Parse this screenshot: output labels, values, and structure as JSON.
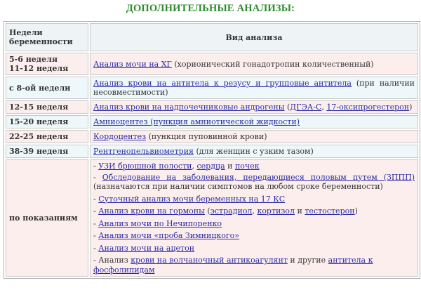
{
  "title": "ДОПОЛНИТЕЛЬНЫЕ АНАЛИЗЫ:",
  "header": {
    "weeks": "Недели беременности",
    "type": "Вид анализа"
  },
  "rows": [
    {
      "weeks": [
        "5-6 неделя",
        "11-12 неделя"
      ],
      "link": "Анализ мочи на ХГ",
      "rest": " (хорионический гонадотропин количественный)"
    },
    {
      "weeks": [
        "с 8-ой недели"
      ],
      "link": "Анализ крови на антитела к резусу и групповые антитела",
      "rest": " (при наличии несовместимости)"
    },
    {
      "weeks": [
        "12-15 неделя"
      ],
      "link": "Анализ крови на надпочечниковые андрогены",
      "t1": " (",
      "link2": "ДГЭА-С",
      "t2": ", ",
      "link3": "17-оксипрогестерон",
      "t3": ")"
    },
    {
      "weeks": [
        "15-20 неделя"
      ],
      "link": "Амниоцентез (пункция амниотической жидкости)"
    },
    {
      "weeks": [
        "22-25 неделя"
      ],
      "link": "Кордоцентез",
      "rest": " (пункция пуповинной крови)"
    },
    {
      "weeks": [
        "38-39 неделя"
      ],
      "link": "Рентгенопельвиометрия",
      "rest": " (для женщин с узким тазом)"
    }
  ],
  "indications": {
    "weeks": "по показаниям",
    "i1": {
      "dash": "- ",
      "l1": "УЗИ брюшной полости",
      "s1": ", ",
      "l2": "сердца",
      "s2": " и ",
      "l3": "почек"
    },
    "i2": {
      "dash": "- ",
      "l1": "Обследование на заболевания, передающиеся половым путем (ЗППП)",
      "rest": " (назначаются при наличии симптомов на любом сроке беременности)"
    },
    "i3": {
      "dash": "- ",
      "l1": "Суточный анализ мочи беременных на 17 КС"
    },
    "i4": {
      "dash": "- ",
      "l1": "Анализ крови на гормоны",
      "s1": " (",
      "l2": "эстрадиол",
      "s2": ", ",
      "l3": "кортизол",
      "s3": " и ",
      "l4": "тестостерон",
      "s4": ")"
    },
    "i5": {
      "dash": "- ",
      "l1": "Анализ мочи по Нечипоренко"
    },
    "i6": {
      "dash": "- ",
      "l1": "Анализ мочи «проба Зимницкого»"
    },
    "i7": {
      "dash": "- ",
      "l1": "Анализ мочи на ацетон"
    },
    "i8": {
      "dash": "- Анализ ",
      "l1": "крови на волчаночный антикоагулянт",
      "s1": " и другие ",
      "l2": "антитела к фосфолипидам"
    }
  }
}
